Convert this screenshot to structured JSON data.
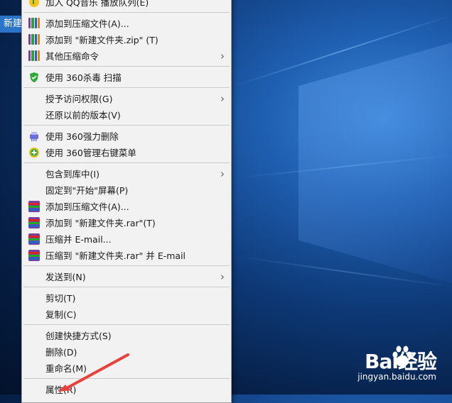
{
  "desktop": {
    "icon_label": "新建"
  },
  "menu": {
    "items": [
      {
        "label": "加入 QQ音乐 播放队列(E)",
        "icon": "qq-music-icon",
        "submenu": false
      },
      {
        "sep": true
      },
      {
        "label": "添加到压缩文件(A)...",
        "icon": "winrar-books-icon",
        "submenu": false
      },
      {
        "label": "添加到 \"新建文件夹.zip\" (T)",
        "icon": "winrar-books-icon",
        "submenu": false
      },
      {
        "label": "其他压缩命令",
        "icon": "winrar-books-icon",
        "submenu": true
      },
      {
        "sep": true
      },
      {
        "label": "使用 360杀毒 扫描",
        "icon": "shield-icon",
        "submenu": false
      },
      {
        "sep": true
      },
      {
        "label": "授予访问权限(G)",
        "icon": "",
        "submenu": true
      },
      {
        "label": "还原以前的版本(V)",
        "icon": "",
        "submenu": false
      },
      {
        "sep": true
      },
      {
        "label": "使用 360强力删除",
        "icon": "shredder-icon",
        "submenu": false
      },
      {
        "label": "使用 360管理右键菜单",
        "icon": "plus-circle-icon",
        "submenu": false
      },
      {
        "sep": true
      },
      {
        "label": "包含到库中(I)",
        "icon": "",
        "submenu": true
      },
      {
        "label": "固定到\"开始\"屏幕(P)",
        "icon": "",
        "submenu": false
      },
      {
        "label": "添加到压缩文件(A)...",
        "icon": "rar-icon",
        "submenu": false
      },
      {
        "label": "添加到 \"新建文件夹.rar\"(T)",
        "icon": "rar-icon",
        "submenu": false
      },
      {
        "label": "压缩并 E-mail...",
        "icon": "rar-icon",
        "submenu": false
      },
      {
        "label": "压缩到 \"新建文件夹.rar\" 并 E-mail",
        "icon": "rar-icon",
        "submenu": false
      },
      {
        "sep": true
      },
      {
        "label": "发送到(N)",
        "icon": "",
        "submenu": true
      },
      {
        "sep": true
      },
      {
        "label": "剪切(T)",
        "icon": "",
        "submenu": false
      },
      {
        "label": "复制(C)",
        "icon": "",
        "submenu": false
      },
      {
        "sep": true
      },
      {
        "label": "创建快捷方式(S)",
        "icon": "",
        "submenu": false
      },
      {
        "label": "删除(D)",
        "icon": "",
        "submenu": false
      },
      {
        "label": "重命名(M)",
        "icon": "",
        "submenu": false
      },
      {
        "sep": true
      },
      {
        "label": "属性(R)",
        "icon": "",
        "submenu": false
      }
    ]
  },
  "annotation": {
    "arrow_color": "#e8403a"
  },
  "watermark": {
    "main": "Bai经验",
    "sub": "jingyan.baidu.com"
  }
}
